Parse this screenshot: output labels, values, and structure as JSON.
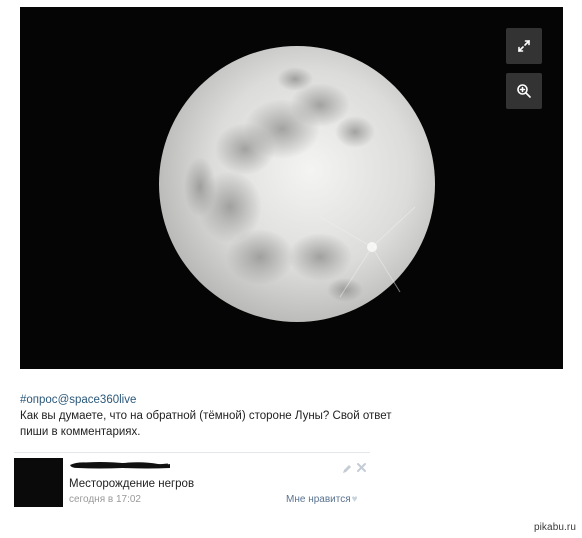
{
  "post": {
    "image_alt": "full moon",
    "hashtag": "#опрос",
    "mention": "@space360live",
    "text": "Как вы думаете, что на обратной (тёмной) стороне Луны? Свой ответ пиши в комментариях."
  },
  "photo_controls": {
    "expand_icon": "expand-arrows-icon",
    "zoom_icon": "zoom-in-icon"
  },
  "comment": {
    "author": "",
    "text": "Месторождение негров",
    "date": "сегодня в 17:02",
    "like_label": "Мне нравится",
    "like_icon": "heart-icon"
  },
  "watermark": "pikabu.ru",
  "colors": {
    "link": "#2b587a",
    "muted": "#999999",
    "like": "#5a7391"
  }
}
